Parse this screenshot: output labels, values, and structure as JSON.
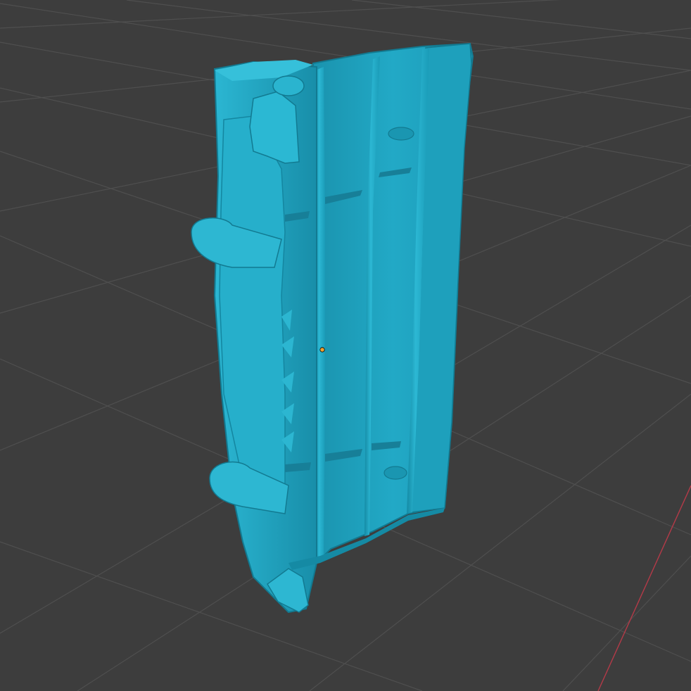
{
  "viewport": {
    "background_color": "#3d3d3d",
    "grid_color": "#4f4f4f",
    "x_axis_color": "#b43a48",
    "origin_color": "#f0a030"
  },
  "model": {
    "color": "#1fa3bf",
    "highlight_color": "#3dc3dc",
    "shadow_color": "#127a91"
  }
}
